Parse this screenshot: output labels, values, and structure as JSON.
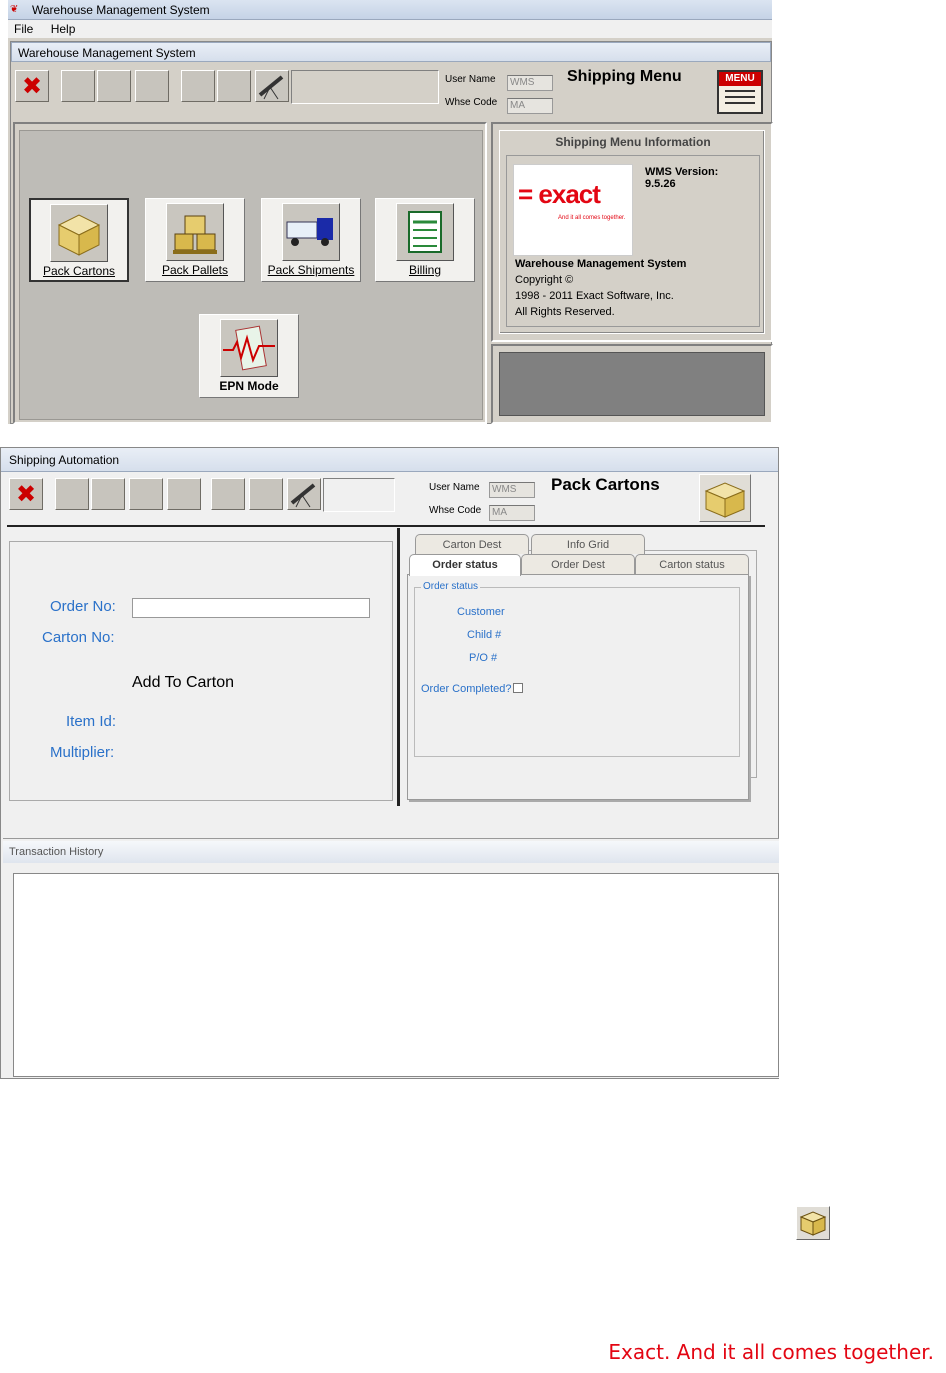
{
  "win1": {
    "app_title": "Warehouse Management System",
    "menu": [
      "File",
      "Help"
    ],
    "inner_title": "Warehouse Management System",
    "user_label": "User Name",
    "user_value": "WMS",
    "whse_label": "Whse Code",
    "whse_value": "MA",
    "screen_title": "Shipping Menu",
    "menu_icon_text": "MENU",
    "buttons": [
      "Pack Cartons",
      "Pack Pallets",
      "Pack Shipments",
      "Billing",
      "EPN Mode"
    ],
    "info": {
      "header": "Shipping Menu Information",
      "logo_text": "= exact",
      "logo_tagline": "And it all comes together.",
      "version_label": "WMS Version:",
      "version_value": "9.5.26",
      "product": "Warehouse Management System",
      "copyright": "Copyright    ©",
      "years": "1998 - 2011  Exact Software, Inc.",
      "rights": "All Rights Reserved."
    }
  },
  "win2": {
    "title": "Shipping Automation",
    "user_label": "User Name",
    "user_value": "WMS",
    "whse_label": "Whse Code",
    "whse_value": "MA",
    "screen_title": "Pack Cartons",
    "order_no_label": "Order No:",
    "order_no_value": "",
    "carton_no_label": "Carton No:",
    "add_to_carton": "Add To Carton",
    "item_id_label": "Item Id:",
    "multiplier_label": "Multiplier:",
    "tabs_back": [
      "Carton Dest",
      "Info Grid"
    ],
    "tabs_front": [
      "Order status",
      "Order Dest",
      "Carton status"
    ],
    "group_label": "Order status",
    "fields": [
      "Customer",
      "Child #",
      "P/O #"
    ],
    "order_completed_label": "Order Completed?",
    "history_title": "Transaction History"
  },
  "footer": {
    "tagline": "Exact. And it all comes together."
  }
}
